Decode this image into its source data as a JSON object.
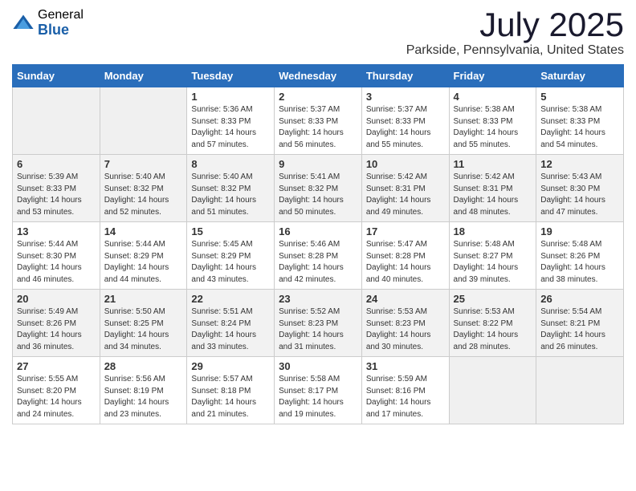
{
  "header": {
    "logo_general": "General",
    "logo_blue": "Blue",
    "title": "July 2025",
    "location": "Parkside, Pennsylvania, United States"
  },
  "days_of_week": [
    "Sunday",
    "Monday",
    "Tuesday",
    "Wednesday",
    "Thursday",
    "Friday",
    "Saturday"
  ],
  "weeks": [
    [
      {
        "day": "",
        "sunrise": "",
        "sunset": "",
        "daylight": ""
      },
      {
        "day": "",
        "sunrise": "",
        "sunset": "",
        "daylight": ""
      },
      {
        "day": "1",
        "sunrise": "Sunrise: 5:36 AM",
        "sunset": "Sunset: 8:33 PM",
        "daylight": "Daylight: 14 hours and 57 minutes."
      },
      {
        "day": "2",
        "sunrise": "Sunrise: 5:37 AM",
        "sunset": "Sunset: 8:33 PM",
        "daylight": "Daylight: 14 hours and 56 minutes."
      },
      {
        "day": "3",
        "sunrise": "Sunrise: 5:37 AM",
        "sunset": "Sunset: 8:33 PM",
        "daylight": "Daylight: 14 hours and 55 minutes."
      },
      {
        "day": "4",
        "sunrise": "Sunrise: 5:38 AM",
        "sunset": "Sunset: 8:33 PM",
        "daylight": "Daylight: 14 hours and 55 minutes."
      },
      {
        "day": "5",
        "sunrise": "Sunrise: 5:38 AM",
        "sunset": "Sunset: 8:33 PM",
        "daylight": "Daylight: 14 hours and 54 minutes."
      }
    ],
    [
      {
        "day": "6",
        "sunrise": "Sunrise: 5:39 AM",
        "sunset": "Sunset: 8:33 PM",
        "daylight": "Daylight: 14 hours and 53 minutes."
      },
      {
        "day": "7",
        "sunrise": "Sunrise: 5:40 AM",
        "sunset": "Sunset: 8:32 PM",
        "daylight": "Daylight: 14 hours and 52 minutes."
      },
      {
        "day": "8",
        "sunrise": "Sunrise: 5:40 AM",
        "sunset": "Sunset: 8:32 PM",
        "daylight": "Daylight: 14 hours and 51 minutes."
      },
      {
        "day": "9",
        "sunrise": "Sunrise: 5:41 AM",
        "sunset": "Sunset: 8:32 PM",
        "daylight": "Daylight: 14 hours and 50 minutes."
      },
      {
        "day": "10",
        "sunrise": "Sunrise: 5:42 AM",
        "sunset": "Sunset: 8:31 PM",
        "daylight": "Daylight: 14 hours and 49 minutes."
      },
      {
        "day": "11",
        "sunrise": "Sunrise: 5:42 AM",
        "sunset": "Sunset: 8:31 PM",
        "daylight": "Daylight: 14 hours and 48 minutes."
      },
      {
        "day": "12",
        "sunrise": "Sunrise: 5:43 AM",
        "sunset": "Sunset: 8:30 PM",
        "daylight": "Daylight: 14 hours and 47 minutes."
      }
    ],
    [
      {
        "day": "13",
        "sunrise": "Sunrise: 5:44 AM",
        "sunset": "Sunset: 8:30 PM",
        "daylight": "Daylight: 14 hours and 46 minutes."
      },
      {
        "day": "14",
        "sunrise": "Sunrise: 5:44 AM",
        "sunset": "Sunset: 8:29 PM",
        "daylight": "Daylight: 14 hours and 44 minutes."
      },
      {
        "day": "15",
        "sunrise": "Sunrise: 5:45 AM",
        "sunset": "Sunset: 8:29 PM",
        "daylight": "Daylight: 14 hours and 43 minutes."
      },
      {
        "day": "16",
        "sunrise": "Sunrise: 5:46 AM",
        "sunset": "Sunset: 8:28 PM",
        "daylight": "Daylight: 14 hours and 42 minutes."
      },
      {
        "day": "17",
        "sunrise": "Sunrise: 5:47 AM",
        "sunset": "Sunset: 8:28 PM",
        "daylight": "Daylight: 14 hours and 40 minutes."
      },
      {
        "day": "18",
        "sunrise": "Sunrise: 5:48 AM",
        "sunset": "Sunset: 8:27 PM",
        "daylight": "Daylight: 14 hours and 39 minutes."
      },
      {
        "day": "19",
        "sunrise": "Sunrise: 5:48 AM",
        "sunset": "Sunset: 8:26 PM",
        "daylight": "Daylight: 14 hours and 38 minutes."
      }
    ],
    [
      {
        "day": "20",
        "sunrise": "Sunrise: 5:49 AM",
        "sunset": "Sunset: 8:26 PM",
        "daylight": "Daylight: 14 hours and 36 minutes."
      },
      {
        "day": "21",
        "sunrise": "Sunrise: 5:50 AM",
        "sunset": "Sunset: 8:25 PM",
        "daylight": "Daylight: 14 hours and 34 minutes."
      },
      {
        "day": "22",
        "sunrise": "Sunrise: 5:51 AM",
        "sunset": "Sunset: 8:24 PM",
        "daylight": "Daylight: 14 hours and 33 minutes."
      },
      {
        "day": "23",
        "sunrise": "Sunrise: 5:52 AM",
        "sunset": "Sunset: 8:23 PM",
        "daylight": "Daylight: 14 hours and 31 minutes."
      },
      {
        "day": "24",
        "sunrise": "Sunrise: 5:53 AM",
        "sunset": "Sunset: 8:23 PM",
        "daylight": "Daylight: 14 hours and 30 minutes."
      },
      {
        "day": "25",
        "sunrise": "Sunrise: 5:53 AM",
        "sunset": "Sunset: 8:22 PM",
        "daylight": "Daylight: 14 hours and 28 minutes."
      },
      {
        "day": "26",
        "sunrise": "Sunrise: 5:54 AM",
        "sunset": "Sunset: 8:21 PM",
        "daylight": "Daylight: 14 hours and 26 minutes."
      }
    ],
    [
      {
        "day": "27",
        "sunrise": "Sunrise: 5:55 AM",
        "sunset": "Sunset: 8:20 PM",
        "daylight": "Daylight: 14 hours and 24 minutes."
      },
      {
        "day": "28",
        "sunrise": "Sunrise: 5:56 AM",
        "sunset": "Sunset: 8:19 PM",
        "daylight": "Daylight: 14 hours and 23 minutes."
      },
      {
        "day": "29",
        "sunrise": "Sunrise: 5:57 AM",
        "sunset": "Sunset: 8:18 PM",
        "daylight": "Daylight: 14 hours and 21 minutes."
      },
      {
        "day": "30",
        "sunrise": "Sunrise: 5:58 AM",
        "sunset": "Sunset: 8:17 PM",
        "daylight": "Daylight: 14 hours and 19 minutes."
      },
      {
        "day": "31",
        "sunrise": "Sunrise: 5:59 AM",
        "sunset": "Sunset: 8:16 PM",
        "daylight": "Daylight: 14 hours and 17 minutes."
      },
      {
        "day": "",
        "sunrise": "",
        "sunset": "",
        "daylight": ""
      },
      {
        "day": "",
        "sunrise": "",
        "sunset": "",
        "daylight": ""
      }
    ]
  ]
}
